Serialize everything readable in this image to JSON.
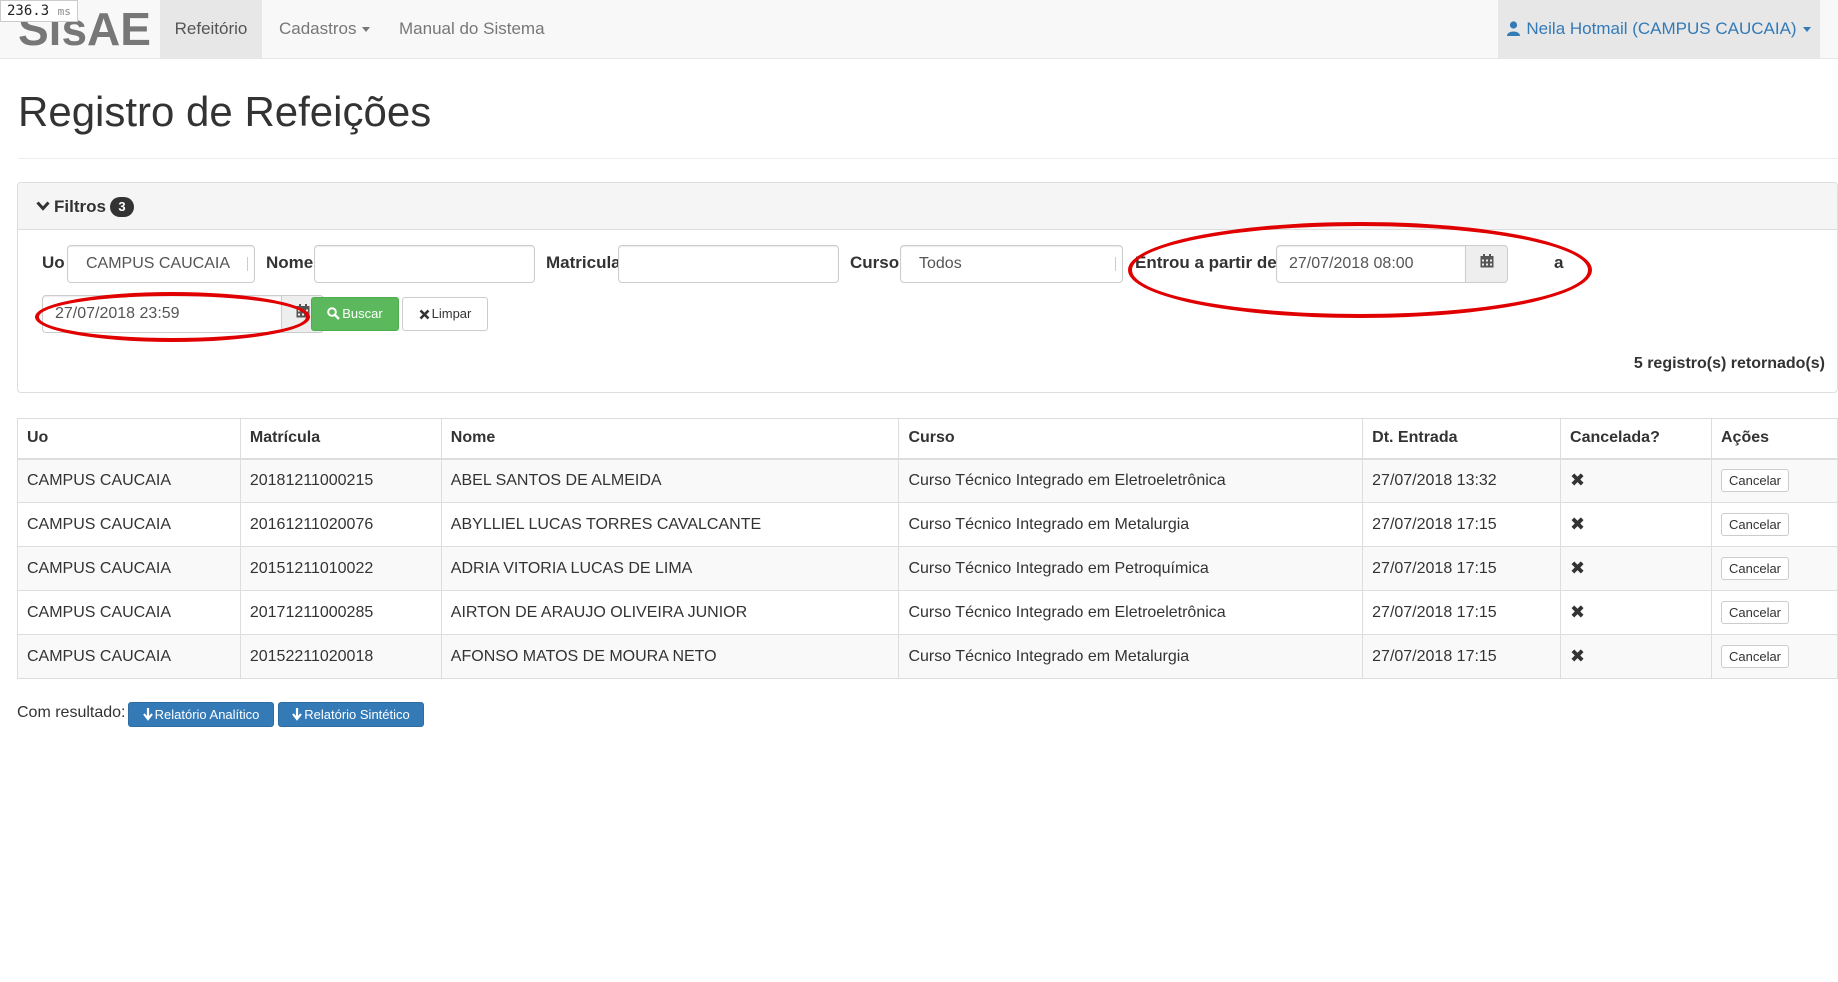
{
  "timer": {
    "value": "236.3",
    "unit": "ms"
  },
  "navbar": {
    "brand": "SisAE",
    "items": [
      {
        "label": "Refeitório"
      },
      {
        "label": "Cadastros"
      },
      {
        "label": "Manual do Sistema"
      }
    ],
    "user": "Neila Hotmail (CAMPUS CAUCAIA)"
  },
  "page": {
    "title": "Registro de Refeições"
  },
  "filters": {
    "heading": "Filtros",
    "count": "3",
    "uo_label": "Uo",
    "uo_value": "CAMPUS CAUCAIA",
    "nome_label": "Nome",
    "nome_value": "",
    "matricula_label": "Matricula",
    "matricula_value": "",
    "curso_label": "Curso",
    "curso_value": "Todos",
    "entrou_label": "Entrou a partir de",
    "date_from": "27/07/2018 08:00",
    "a_label": "a",
    "date_to": "27/07/2018 23:59",
    "buscar_label": "Buscar",
    "limpar_label": "Limpar",
    "records_text": "5 registro(s) retornado(s)"
  },
  "table": {
    "headers": [
      "Uo",
      "Matrícula",
      "Nome",
      "Curso",
      "Dt. Entrada",
      "Cancelada?",
      "Ações"
    ],
    "cancel_label": "Cancelar",
    "cancel_mark": "✖",
    "rows": [
      {
        "uo": "CAMPUS CAUCAIA",
        "matricula": "20181211000215",
        "nome": "ABEL SANTOS DE ALMEIDA",
        "curso": "Curso Técnico Integrado em Eletroeletrônica",
        "entrada": "27/07/2018 13:32"
      },
      {
        "uo": "CAMPUS CAUCAIA",
        "matricula": "20161211020076",
        "nome": "ABYLLIEL LUCAS TORRES CAVALCANTE",
        "curso": "Curso Técnico Integrado em Metalurgia",
        "entrada": "27/07/2018 17:15"
      },
      {
        "uo": "CAMPUS CAUCAIA",
        "matricula": "20151211010022",
        "nome": "ADRIA VITORIA LUCAS DE LIMA",
        "curso": "Curso Técnico Integrado em Petroquímica",
        "entrada": "27/07/2018 17:15"
      },
      {
        "uo": "CAMPUS CAUCAIA",
        "matricula": "20171211000285",
        "nome": "AIRTON DE ARAUJO OLIVEIRA JUNIOR",
        "curso": "Curso Técnico Integrado em Eletroeletrônica",
        "entrada": "27/07/2018 17:15"
      },
      {
        "uo": "CAMPUS CAUCAIA",
        "matricula": "20152211020018",
        "nome": "AFONSO MATOS DE MOURA NETO",
        "curso": "Curso Técnico Integrado em Metalurgia",
        "entrada": "27/07/2018 17:15"
      }
    ]
  },
  "footer": {
    "label": "Com resultado:",
    "analitico_label": "Relatório Analítico",
    "sintetico_label": "Relatório Sintético"
  },
  "colors": {
    "accent": "#337ab7",
    "success": "#5cb85c",
    "annotation": "#e00000"
  }
}
